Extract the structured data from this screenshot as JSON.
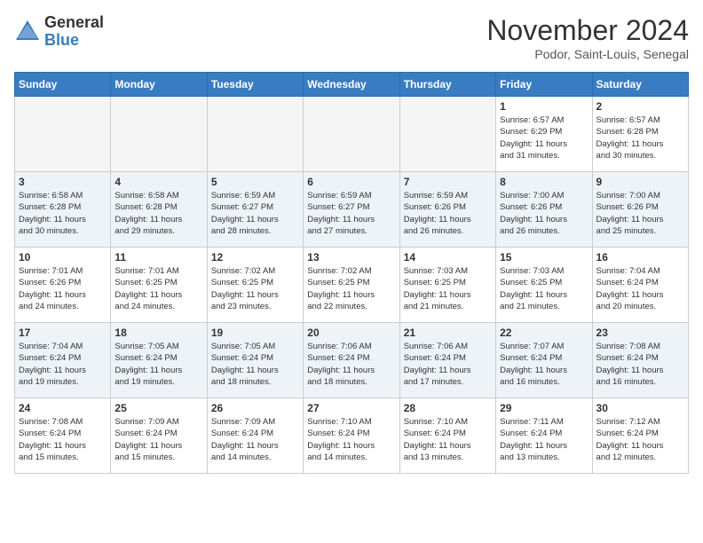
{
  "header": {
    "logo_general": "General",
    "logo_blue": "Blue",
    "month_title": "November 2024",
    "location": "Podor, Saint-Louis, Senegal"
  },
  "weekdays": [
    "Sunday",
    "Monday",
    "Tuesday",
    "Wednesday",
    "Thursday",
    "Friday",
    "Saturday"
  ],
  "weeks": [
    [
      {
        "day": "",
        "info": ""
      },
      {
        "day": "",
        "info": ""
      },
      {
        "day": "",
        "info": ""
      },
      {
        "day": "",
        "info": ""
      },
      {
        "day": "",
        "info": ""
      },
      {
        "day": "1",
        "info": "Sunrise: 6:57 AM\nSunset: 6:29 PM\nDaylight: 11 hours\nand 31 minutes."
      },
      {
        "day": "2",
        "info": "Sunrise: 6:57 AM\nSunset: 6:28 PM\nDaylight: 11 hours\nand 30 minutes."
      }
    ],
    [
      {
        "day": "3",
        "info": "Sunrise: 6:58 AM\nSunset: 6:28 PM\nDaylight: 11 hours\nand 30 minutes."
      },
      {
        "day": "4",
        "info": "Sunrise: 6:58 AM\nSunset: 6:28 PM\nDaylight: 11 hours\nand 29 minutes."
      },
      {
        "day": "5",
        "info": "Sunrise: 6:59 AM\nSunset: 6:27 PM\nDaylight: 11 hours\nand 28 minutes."
      },
      {
        "day": "6",
        "info": "Sunrise: 6:59 AM\nSunset: 6:27 PM\nDaylight: 11 hours\nand 27 minutes."
      },
      {
        "day": "7",
        "info": "Sunrise: 6:59 AM\nSunset: 6:26 PM\nDaylight: 11 hours\nand 26 minutes."
      },
      {
        "day": "8",
        "info": "Sunrise: 7:00 AM\nSunset: 6:26 PM\nDaylight: 11 hours\nand 26 minutes."
      },
      {
        "day": "9",
        "info": "Sunrise: 7:00 AM\nSunset: 6:26 PM\nDaylight: 11 hours\nand 25 minutes."
      }
    ],
    [
      {
        "day": "10",
        "info": "Sunrise: 7:01 AM\nSunset: 6:26 PM\nDaylight: 11 hours\nand 24 minutes."
      },
      {
        "day": "11",
        "info": "Sunrise: 7:01 AM\nSunset: 6:25 PM\nDaylight: 11 hours\nand 24 minutes."
      },
      {
        "day": "12",
        "info": "Sunrise: 7:02 AM\nSunset: 6:25 PM\nDaylight: 11 hours\nand 23 minutes."
      },
      {
        "day": "13",
        "info": "Sunrise: 7:02 AM\nSunset: 6:25 PM\nDaylight: 11 hours\nand 22 minutes."
      },
      {
        "day": "14",
        "info": "Sunrise: 7:03 AM\nSunset: 6:25 PM\nDaylight: 11 hours\nand 21 minutes."
      },
      {
        "day": "15",
        "info": "Sunrise: 7:03 AM\nSunset: 6:25 PM\nDaylight: 11 hours\nand 21 minutes."
      },
      {
        "day": "16",
        "info": "Sunrise: 7:04 AM\nSunset: 6:24 PM\nDaylight: 11 hours\nand 20 minutes."
      }
    ],
    [
      {
        "day": "17",
        "info": "Sunrise: 7:04 AM\nSunset: 6:24 PM\nDaylight: 11 hours\nand 19 minutes."
      },
      {
        "day": "18",
        "info": "Sunrise: 7:05 AM\nSunset: 6:24 PM\nDaylight: 11 hours\nand 19 minutes."
      },
      {
        "day": "19",
        "info": "Sunrise: 7:05 AM\nSunset: 6:24 PM\nDaylight: 11 hours\nand 18 minutes."
      },
      {
        "day": "20",
        "info": "Sunrise: 7:06 AM\nSunset: 6:24 PM\nDaylight: 11 hours\nand 18 minutes."
      },
      {
        "day": "21",
        "info": "Sunrise: 7:06 AM\nSunset: 6:24 PM\nDaylight: 11 hours\nand 17 minutes."
      },
      {
        "day": "22",
        "info": "Sunrise: 7:07 AM\nSunset: 6:24 PM\nDaylight: 11 hours\nand 16 minutes."
      },
      {
        "day": "23",
        "info": "Sunrise: 7:08 AM\nSunset: 6:24 PM\nDaylight: 11 hours\nand 16 minutes."
      }
    ],
    [
      {
        "day": "24",
        "info": "Sunrise: 7:08 AM\nSunset: 6:24 PM\nDaylight: 11 hours\nand 15 minutes."
      },
      {
        "day": "25",
        "info": "Sunrise: 7:09 AM\nSunset: 6:24 PM\nDaylight: 11 hours\nand 15 minutes."
      },
      {
        "day": "26",
        "info": "Sunrise: 7:09 AM\nSunset: 6:24 PM\nDaylight: 11 hours\nand 14 minutes."
      },
      {
        "day": "27",
        "info": "Sunrise: 7:10 AM\nSunset: 6:24 PM\nDaylight: 11 hours\nand 14 minutes."
      },
      {
        "day": "28",
        "info": "Sunrise: 7:10 AM\nSunset: 6:24 PM\nDaylight: 11 hours\nand 13 minutes."
      },
      {
        "day": "29",
        "info": "Sunrise: 7:11 AM\nSunset: 6:24 PM\nDaylight: 11 hours\nand 13 minutes."
      },
      {
        "day": "30",
        "info": "Sunrise: 7:12 AM\nSunset: 6:24 PM\nDaylight: 11 hours\nand 12 minutes."
      }
    ]
  ]
}
